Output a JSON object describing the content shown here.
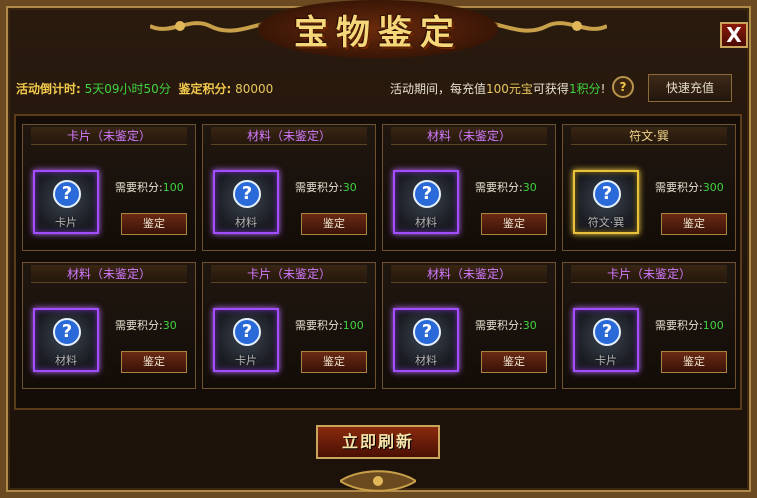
{
  "title": "宝物鉴定",
  "close_label": "X",
  "countdown": {
    "label": "活动倒计时:",
    "value": "5天09小时50分"
  },
  "points": {
    "label": "鉴定积分:",
    "value": "80000"
  },
  "promo": {
    "prefix": "活动期间，每充值",
    "amount": "100元宝",
    "middle": "可获得",
    "reward": "1积分",
    "suffix": "!"
  },
  "help_label": "?",
  "recharge_label": "快速充值",
  "need_label": "需要积分:",
  "identify_label": "鉴定",
  "refresh_label": "立即刷新",
  "colors": {
    "purple_rarity": "#a24dff",
    "gold_rarity": "#e8c23a",
    "green_value": "#3fd33f"
  },
  "cards": [
    {
      "title": "卡片（未鉴定）",
      "item": "卡片",
      "cost": "100",
      "rarity": "purple",
      "icon": "question-card-icon"
    },
    {
      "title": "材料（未鉴定）",
      "item": "材料",
      "cost": "30",
      "rarity": "purple",
      "icon": "question-ore-icon"
    },
    {
      "title": "材料（未鉴定）",
      "item": "材料",
      "cost": "30",
      "rarity": "purple",
      "icon": "question-ore-icon"
    },
    {
      "title": "符文·巽",
      "item": "符文·巽",
      "cost": "300",
      "rarity": "gold",
      "icon": "question-rune-icon"
    },
    {
      "title": "材料（未鉴定）",
      "item": "材料",
      "cost": "30",
      "rarity": "purple",
      "icon": "question-ore-icon"
    },
    {
      "title": "卡片（未鉴定）",
      "item": "卡片",
      "cost": "100",
      "rarity": "purple",
      "icon": "question-card-icon"
    },
    {
      "title": "材料（未鉴定）",
      "item": "材料",
      "cost": "30",
      "rarity": "purple",
      "icon": "question-ore-icon"
    },
    {
      "title": "卡片（未鉴定）",
      "item": "卡片",
      "cost": "100",
      "rarity": "purple",
      "icon": "question-card-icon"
    }
  ]
}
